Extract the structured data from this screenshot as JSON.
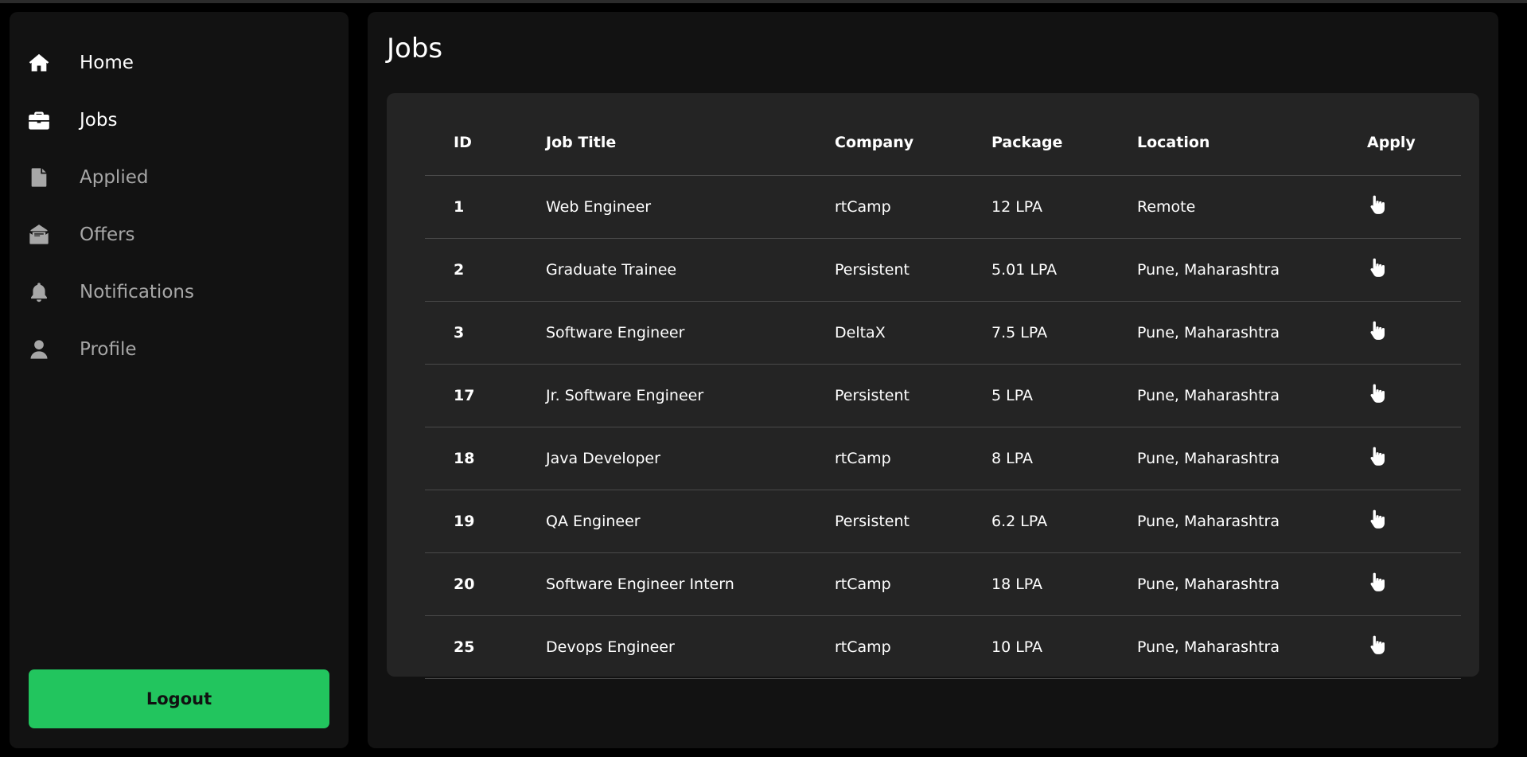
{
  "sidebar": {
    "items": [
      {
        "label": "Home",
        "icon": "home-icon",
        "active": true
      },
      {
        "label": "Jobs",
        "icon": "briefcase-icon",
        "active": true
      },
      {
        "label": "Applied",
        "icon": "file-icon",
        "active": false
      },
      {
        "label": "Offers",
        "icon": "envelope-open-icon",
        "active": false
      },
      {
        "label": "Notifications",
        "icon": "bell-icon",
        "active": false
      },
      {
        "label": "Profile",
        "icon": "user-icon",
        "active": false
      }
    ],
    "logout_label": "Logout"
  },
  "main": {
    "title": "Jobs",
    "table": {
      "headers": [
        "ID",
        "Job Title",
        "Company",
        "Package",
        "Location",
        "Apply"
      ],
      "rows": [
        {
          "id": "1",
          "title": "Web Engineer",
          "company": "rtCamp",
          "package": "12 LPA",
          "location": "Remote"
        },
        {
          "id": "2",
          "title": "Graduate Trainee",
          "company": "Persistent",
          "package": "5.01 LPA",
          "location": "Pune, Maharashtra"
        },
        {
          "id": "3",
          "title": "Software Engineer",
          "company": "DeltaX",
          "package": "7.5 LPA",
          "location": "Pune, Maharashtra"
        },
        {
          "id": "17",
          "title": "Jr. Software Engineer",
          "company": "Persistent",
          "package": "5 LPA",
          "location": "Pune, Maharashtra"
        },
        {
          "id": "18",
          "title": "Java Developer",
          "company": "rtCamp",
          "package": "8 LPA",
          "location": "Pune, Maharashtra"
        },
        {
          "id": "19",
          "title": "QA Engineer",
          "company": "Persistent",
          "package": "6.2 LPA",
          "location": "Pune, Maharashtra"
        },
        {
          "id": "20",
          "title": "Software Engineer Intern",
          "company": "rtCamp",
          "package": "18 LPA",
          "location": "Pune, Maharashtra"
        },
        {
          "id": "25",
          "title": "Devops Engineer",
          "company": "rtCamp",
          "package": "10 LPA",
          "location": "Pune, Maharashtra"
        }
      ],
      "apply_icon": "pointer-hand-icon"
    }
  },
  "colors": {
    "background": "#000000",
    "panel": "#121212",
    "card": "#242424",
    "accent": "#22c55e",
    "muted_text": "#a7a7a7"
  }
}
